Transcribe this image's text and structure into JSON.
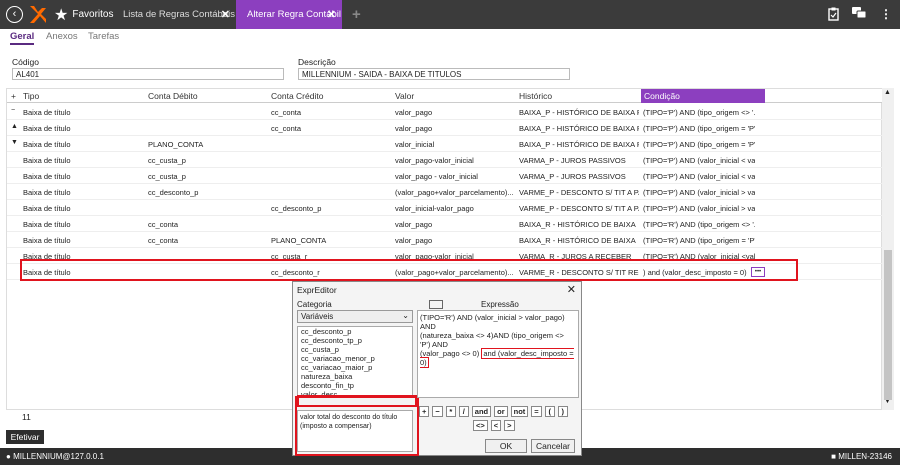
{
  "topbar": {
    "favorites_label": "Favoritos",
    "tabs": [
      {
        "label": "Lista de Regras Contábeis"
      },
      {
        "label": "Alterar Regra Contábil"
      }
    ]
  },
  "subtabs": [
    "Geral",
    "Anexos",
    "Tarefas"
  ],
  "form": {
    "codigo_label": "Código",
    "codigo_value": "AL401",
    "descricao_label": "Descrição",
    "descricao_value": "MILLENNIUM - SAIDA - BAIXA DE TITULOS"
  },
  "grid": {
    "columns": [
      "Tipo",
      "Conta Débito",
      "Conta Crédito",
      "Valor",
      "Histórico",
      "Condição"
    ],
    "rows": [
      {
        "arrow": "−",
        "tipo": "Baixa de título",
        "debito": "",
        "credito": "cc_conta",
        "valor": "valor_pago",
        "historico": "BAIXA_P - HISTÓRICO DE BAIXA PA...",
        "condicao": "(TIPO='P') AND (tipo_origem <> '..."
      },
      {
        "arrow": "▲",
        "tipo": "Baixa de título",
        "debito": "",
        "credito": "cc_conta",
        "valor": "valor_pago",
        "historico": "BAIXA_P - HISTÓRICO DE BAIXA PA...",
        "condicao": "(TIPO='P') AND (tipo_origem = 'P'..."
      },
      {
        "arrow": "▼",
        "tipo": "Baixa de título",
        "debito": "PLANO_CONTA",
        "credito": "",
        "valor": "valor_inicial",
        "historico": "BAIXA_P - HISTÓRICO DE BAIXA PA...",
        "condicao": "(TIPO='P') AND (tipo_origem = 'P'..."
      },
      {
        "arrow": "",
        "tipo": "Baixa de título",
        "debito": "cc_custa_p",
        "credito": "",
        "valor": "valor_pago-valor_inicial",
        "historico": "VARMA_P - JUROS PASSIVOS",
        "condicao": "(TIPO='P') AND (valor_inicial < val..."
      },
      {
        "arrow": "",
        "tipo": "Baixa de título",
        "debito": "cc_custa_p",
        "credito": "",
        "valor": "valor_pago - valor_inicial",
        "historico": "VARMA_P - JUROS PASSIVOS",
        "condicao": "(TIPO='P') AND (valor_inicial < val..."
      },
      {
        "arrow": "",
        "tipo": "Baixa de título",
        "debito": "cc_desconto_p",
        "credito": "",
        "valor": "(valor_pago+valor_parcelamento)...",
        "historico": "VARME_P - DESCONTO S/ TIT A PA...",
        "condicao": "(TIPO='P') AND (valor_inicial > val..."
      },
      {
        "arrow": "",
        "tipo": "Baixa de título",
        "debito": "",
        "credito": "cc_desconto_p",
        "valor": "valor_inicial-valor_pago",
        "historico": "VARME_P - DESCONTO S/ TIT A PA...",
        "condicao": "(TIPO='P') AND (valor_inicial > val..."
      },
      {
        "arrow": "",
        "tipo": "Baixa de título",
        "debito": "cc_conta",
        "credito": "",
        "valor": "valor_pago",
        "historico": "BAIXA_R - HISTÓRICO DE BAIXA",
        "condicao": "(TIPO='R') AND (tipo_origem <> '..."
      },
      {
        "arrow": "",
        "tipo": "Baixa de título",
        "debito": "cc_conta",
        "credito": "PLANO_CONTA",
        "valor": "valor_pago",
        "historico": "BAIXA_R - HISTÓRICO DE BAIXA",
        "condicao": "(TIPO='R') AND (tipo_origem = 'P'..."
      },
      {
        "arrow": "",
        "tipo": "Baixa de título",
        "debito": "",
        "credito": "cc_custa_r",
        "valor": "valor_pago-valor_inicial",
        "historico": "VARMA_R - JUROS A RECEBER",
        "condicao": "(TIPO='R') AND (valor_inicial <val..."
      },
      {
        "arrow": "",
        "tipo": "Baixa de título",
        "debito": "",
        "credito": "cc_desconto_r",
        "valor": "(valor_pago+valor_parcelamento)...",
        "historico": "VARME_R - DESCONTO S/ TIT REC...",
        "condicao": ") and (valor_desc_imposto = 0)"
      }
    ],
    "more_glyph": "•••",
    "row_count": "11"
  },
  "efetivar_label": "Efetivar",
  "status": {
    "left": "MILLENNIUM@127.0.0.1",
    "right": "MILLEN-23146"
  },
  "expr_editor": {
    "title": "ExprEditor",
    "categoria_label": "Categoria",
    "categoria_value": "Variáveis",
    "variables": [
      "cc_desconto_p",
      "cc_desconto_tp_p",
      "cc_custa_p",
      "cc_variacao_menor_p",
      "cc_variacao_maior_p",
      "natureza_baixa",
      "desconto_fin_tp",
      "valor_desc",
      "valor_desc_imposto"
    ],
    "description": "valor total do desconto do título (imposto a compensar)",
    "expressao_label": "Expressão",
    "expression_lines": [
      "(TIPO='R') AND (valor_inicial > valor_pago) AND",
      "(natureza_baixa <> 4)AND (tipo_origem <> 'P') AND",
      "(valor_pago <> 0)"
    ],
    "expression_appended": "and (valor_desc_imposto = 0)",
    "ops_row1": [
      "+",
      "−",
      "*",
      "/",
      "and",
      "or",
      "not",
      "=",
      "(",
      ")"
    ],
    "ops_row2": [
      "<>",
      "<",
      ">"
    ],
    "ok_label": "OK",
    "cancel_label": "Cancelar"
  }
}
